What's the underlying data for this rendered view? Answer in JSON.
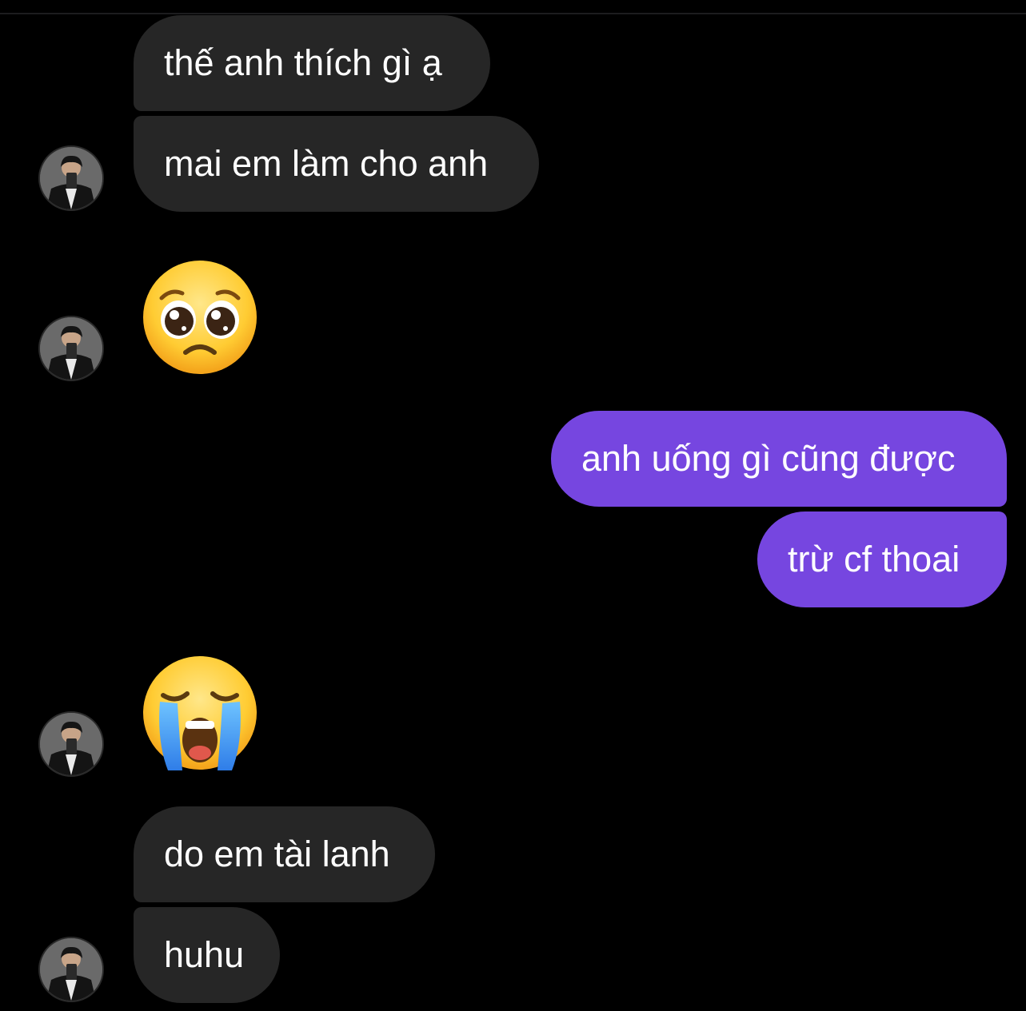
{
  "conversation": {
    "messages": [
      {
        "sender": "other",
        "type": "text",
        "text": "thế anh thích gì ạ"
      },
      {
        "sender": "other",
        "type": "text",
        "text": "mai em làm cho anh"
      },
      {
        "sender": "other",
        "type": "emoji",
        "emoji": "pleading-face"
      },
      {
        "sender": "me",
        "type": "text",
        "text": "anh uống gì cũng được"
      },
      {
        "sender": "me",
        "type": "text",
        "text": "trừ cf thoai"
      },
      {
        "sender": "other",
        "type": "emoji",
        "emoji": "loudly-crying-face"
      },
      {
        "sender": "other",
        "type": "text",
        "text": "do em tài lanh"
      },
      {
        "sender": "other",
        "type": "text",
        "text": "huhu"
      }
    ]
  },
  "theme": {
    "background": "#000000",
    "incoming_bubble": "#262626",
    "outgoing_bubble": "#7646e0",
    "text_color": "#ffffff"
  }
}
